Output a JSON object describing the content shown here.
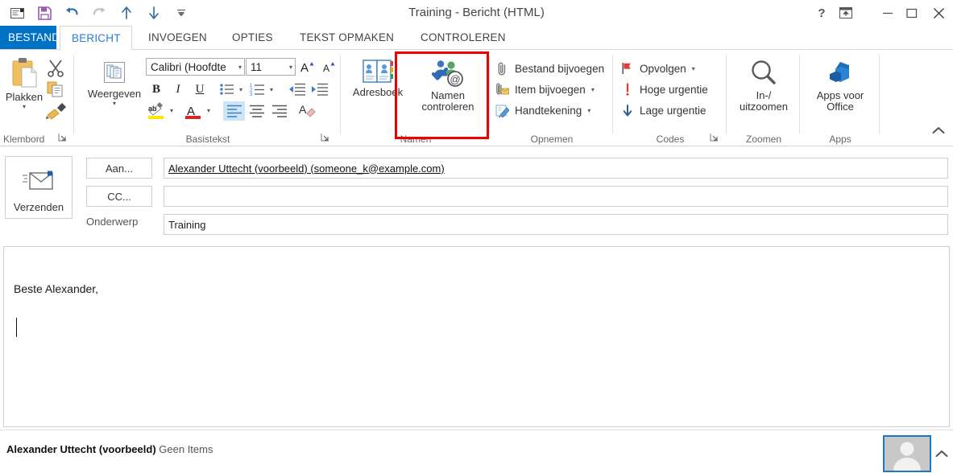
{
  "window": {
    "title": "Training - Bericht (HTML)",
    "quick_access": [
      {
        "name": "new-message-icon",
        "tip": "Nieuw bericht"
      },
      {
        "name": "save-icon",
        "tip": "Opslaan"
      },
      {
        "name": "undo-icon",
        "tip": "Ongedaan maken"
      },
      {
        "name": "redo-icon",
        "tip": "Opnieuw"
      },
      {
        "name": "previous-item-icon",
        "tip": "Vorig item"
      },
      {
        "name": "next-item-icon",
        "tip": "Volgend item"
      },
      {
        "name": "customize-qat-icon",
        "tip": "Werkbalk Snelle toegang aanpassen"
      }
    ],
    "controls": {
      "help": "?",
      "ribbon_display": "ribbon-display-options",
      "minimize": "–",
      "maximize": "□",
      "close": "✕"
    }
  },
  "tabs": [
    {
      "label": "BESTAND",
      "id": "file",
      "active": false
    },
    {
      "label": "BERICHT",
      "id": "bericht",
      "active": true
    },
    {
      "label": "INVOEGEN",
      "id": "invoegen",
      "active": false
    },
    {
      "label": "OPTIES",
      "id": "opties",
      "active": false
    },
    {
      "label": "TEKST OPMAKEN",
      "id": "tekst-opmaken",
      "active": false
    },
    {
      "label": "CONTROLEREN",
      "id": "controleren",
      "active": false
    }
  ],
  "ribbon": {
    "collapse_label": "⌃",
    "groups": {
      "klembord": {
        "label": "Klembord",
        "paste_label": "Plakken",
        "paste_caret": "▾",
        "cut_label": "Knippen",
        "copy_label": "Kopiëren",
        "format_painter_label": "Opmaak kopiëren/plakken",
        "dialog_launcher": "⬌"
      },
      "basistekst": {
        "label": "Basistekst",
        "font_name": "Calibri (Hoofdte",
        "font_size": "11",
        "grow_font": "A",
        "shrink_font": "A",
        "bold": "B",
        "italic": "I",
        "underline": "U",
        "bullets": "bullet-list",
        "numbering": "numbered-list",
        "decrease_indent": "decrease-indent",
        "increase_indent": "increase-indent",
        "highlight": "text-highlight",
        "font_color": "A",
        "align_left": "align-left",
        "align_center": "align-center",
        "align_right": "align-right",
        "clear_formatting": "clear-formatting",
        "dialog_launcher": "⬌"
      },
      "namen": {
        "label": "Namen",
        "addressbook_label": "Adresboek",
        "check_names_label_line1": "Namen",
        "check_names_label_line2": "controleren",
        "highlight_color": "#ee0000"
      },
      "opnemen": {
        "label": "Opnemen",
        "items": [
          {
            "label": "Bestand bijvoegen",
            "icon": "paperclip-icon",
            "caret": ""
          },
          {
            "label": "Item bijvoegen",
            "icon": "attach-item-icon",
            "caret": "▾"
          },
          {
            "label": "Handtekening",
            "icon": "signature-icon",
            "caret": "▾"
          }
        ]
      },
      "codes": {
        "label": "Codes",
        "dialog_launcher": "⬌",
        "items": [
          {
            "label": "Opvolgen",
            "icon": "flag-icon",
            "caret": "▾"
          },
          {
            "label": "Hoge urgentie",
            "icon": "high-importance-icon",
            "caret": ""
          },
          {
            "label": "Lage urgentie",
            "icon": "low-importance-icon",
            "caret": ""
          }
        ]
      },
      "zoomen": {
        "label": "Zoomen",
        "zoom_line1": "In-/",
        "zoom_line2": "uitzoomen",
        "icon": "magnifier-icon"
      },
      "apps": {
        "label": "Apps",
        "apps_line1": "Apps voor",
        "apps_line2": "Office",
        "icon": "office-apps-icon"
      }
    }
  },
  "header": {
    "send_label": "Verzenden",
    "send_icon": "envelope-send-icon",
    "to_button": "Aan...",
    "cc_button": "CC...",
    "subject_label": "Onderwerp",
    "to_value": "Alexander Uttecht (voorbeeld) (someone_k@example.com)",
    "cc_value": "",
    "subject_value": "Training"
  },
  "body": {
    "text": "Beste Alexander,",
    "cursor": "text-cursor"
  },
  "status": {
    "contact_name": "Alexander Uttecht (voorbeeld)",
    "items_text": "Geen Items",
    "people_pane_icon": "contact-photo-icon",
    "expand_chevron": "⌃"
  },
  "colors": {
    "accent_blue": "#0072c6",
    "tab_active_text": "#2b7cd3",
    "highlight_red": "#ee0000",
    "save_icon": "#8e44ad",
    "paste_gold": "#f0c060"
  }
}
